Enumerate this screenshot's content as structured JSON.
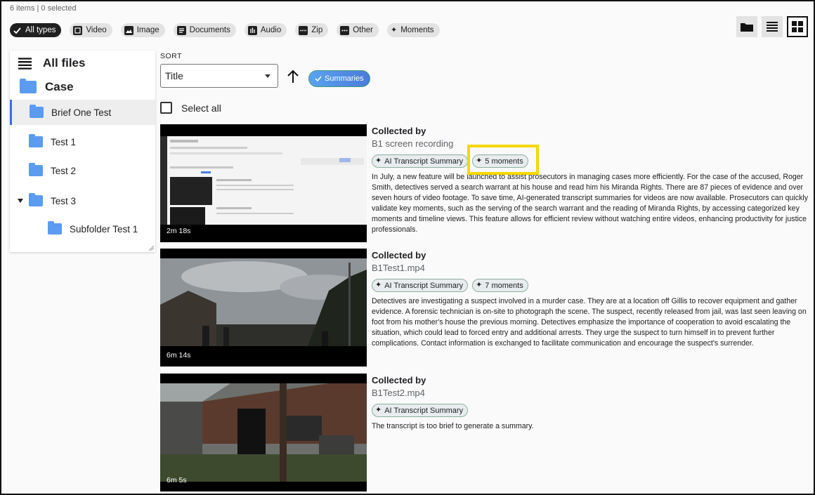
{
  "status": {
    "count_text": "6 items | 0 selected"
  },
  "filters": [
    {
      "label": "All types",
      "icon": "check-icon",
      "active": true
    },
    {
      "label": "Video",
      "icon": "video-icon"
    },
    {
      "label": "Image",
      "icon": "image-icon"
    },
    {
      "label": "Documents",
      "icon": "document-icon"
    },
    {
      "label": "Audio",
      "icon": "audio-icon"
    },
    {
      "label": "Zip",
      "icon": "zip-icon"
    },
    {
      "label": "Other",
      "icon": "more-icon"
    },
    {
      "label": "Moments",
      "icon": "sparkle-icon"
    }
  ],
  "view_buttons": [
    "folder-view-icon",
    "list-view-icon",
    "grid-view-icon"
  ],
  "sidebar": {
    "all_files": "All files",
    "case": "Case",
    "items": [
      {
        "label": "Brief One Test",
        "selected": true
      },
      {
        "label": "Test 1"
      },
      {
        "label": "Test 2"
      },
      {
        "label": "Test 3",
        "expanded": true
      },
      {
        "label": "Subfolder Test 1"
      }
    ]
  },
  "sort": {
    "label": "SORT",
    "selected": "Title",
    "summaries_label": "Summaries"
  },
  "select_all": "Select all",
  "cards": [
    {
      "collected_by": "Collected by",
      "file_name": "B1 screen recording",
      "duration": "2m 18s",
      "badges": [
        "AI Transcript Summary",
        "5 moments"
      ],
      "summary": "In July, a new feature will be launched to assist prosecutors in managing cases more efficiently. For the case of the accused, Roger Smith, detectives served a search warrant at his house and read him his Miranda Rights. There are 87 pieces of evidence and over seven hours of video footage. To save time, AI-generated transcript summaries for videos are now available. Prosecutors can quickly validate key moments, such as the serving of the search warrant and the reading of Miranda Rights, by accessing categorized key moments and timeline views. This feature allows for efficient review without watching entire videos, enhancing productivity for justice professionals."
    },
    {
      "collected_by": "Collected by",
      "file_name": "B1Test1.mp4",
      "duration": "6m 14s",
      "badges": [
        "AI Transcript Summary",
        "7 moments"
      ],
      "summary": "Detectives are investigating a suspect involved in a murder case. They are at a location off Gillis to recover equipment and gather evidence. A forensic technician is on-site to photograph the scene. The suspect, recently released from jail, was last seen leaving on foot from his mother's house the previous morning. Detectives emphasize the importance of cooperation to avoid escalating the situation, which could lead to forced entry and additional arrests. They urge the suspect to turn himself in to prevent further complications. Contact information is exchanged to facilitate communication and encourage the suspect's surrender."
    },
    {
      "collected_by": "Collected by",
      "file_name": "B1Test2.mp4",
      "duration": "6m 5s",
      "badges": [
        "AI Transcript Summary"
      ],
      "summary": "The transcript is too brief to generate a summary."
    }
  ],
  "colors": {
    "accent": "#3c6ee6",
    "folder": "#5b9bf0",
    "highlight": "#f5d800"
  }
}
